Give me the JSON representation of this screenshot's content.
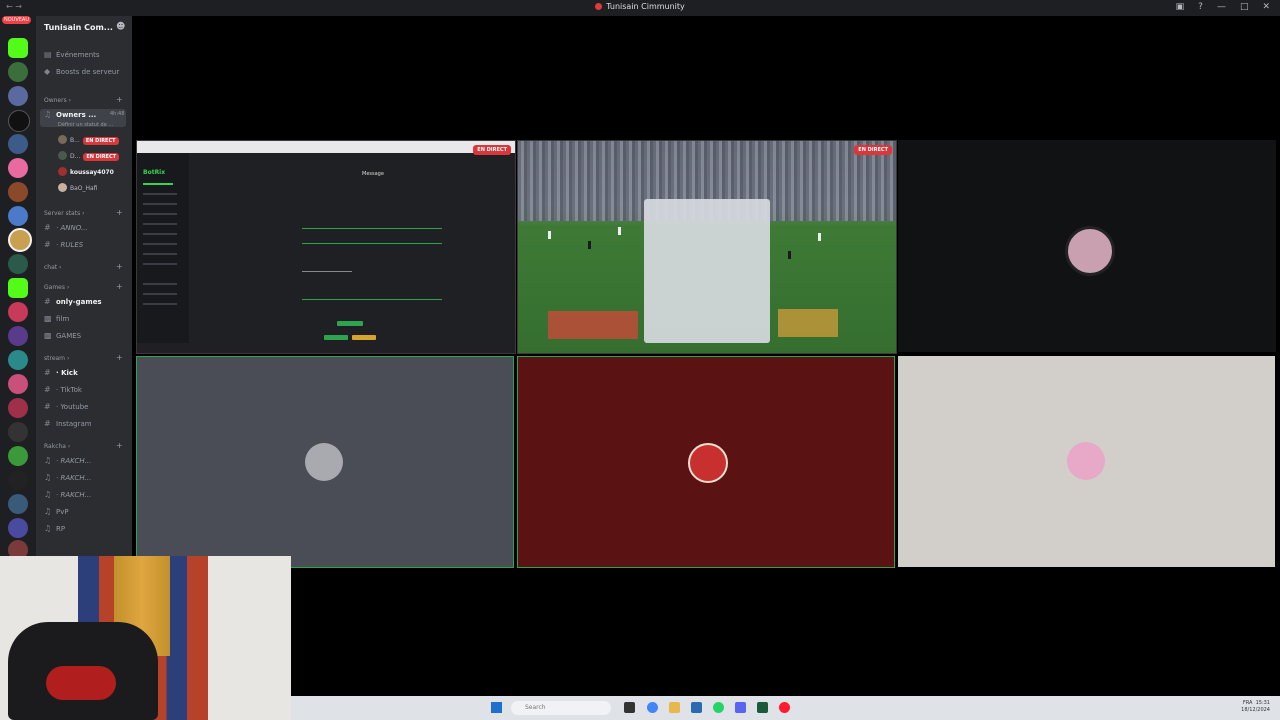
{
  "window": {
    "title": "Tunisain Cimmunity",
    "nav_arrows": "← →"
  },
  "server": {
    "name": "Tunisain Com...",
    "events": "Événements",
    "boosts": "Boosts de serveur",
    "new_badge": "NOUVEAU"
  },
  "categories": {
    "owners": "Owners",
    "server_stats": "Server stats",
    "chat": "chat",
    "games": "Games",
    "stream": "stream",
    "rakcha": "Rakcha"
  },
  "voice_channel": {
    "name": "Owners ...",
    "time": "4h:48",
    "status": "Définir un statut de ...",
    "users": [
      {
        "name": "B...",
        "live": "EN DIRECT"
      },
      {
        "name": "D...",
        "live": "EN DIRECT"
      },
      {
        "name": "koussay4070",
        "live": ""
      },
      {
        "name": "BaO_Hafi",
        "live": ""
      }
    ]
  },
  "channels": {
    "anno": "· ANNO...",
    "rules": "· RULES",
    "only_games": "only-games",
    "film": "film",
    "games": "GAMES",
    "kick": "· Kick",
    "tiktok": "· TikTok",
    "youtube": "· Youtube",
    "instagram": "Instagram",
    "rakch1": "· RAKCH...",
    "rakch2": "· RAKCH...",
    "rakch3": "· RAKCH...",
    "pvp": "PvP",
    "rp": "RP"
  },
  "streams": {
    "live_label": "EN DIRECT",
    "bot_name": "BotRix",
    "bot_page_title": "Message"
  },
  "taskbar": {
    "search_placeholder": "Search",
    "tray_lang": "FRA",
    "tray_time": "15:31",
    "tray_date": "18/12/2024"
  },
  "colors": {
    "live_red": "#da373c",
    "speaking_green": "#2ea44f",
    "sidebar_bg": "#2b2d31",
    "rail_bg": "#1e1f22"
  }
}
